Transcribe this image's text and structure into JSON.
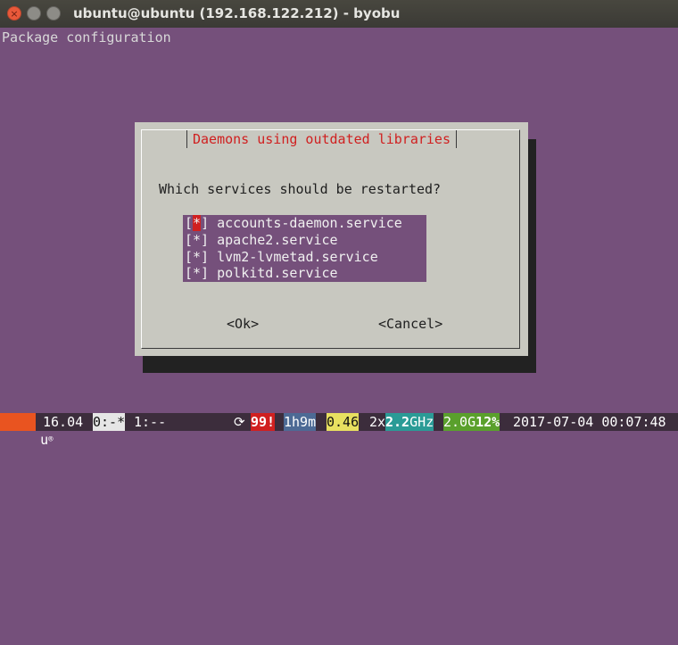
{
  "window": {
    "title": "ubuntu@ubuntu (192.168.122.212) - byobu",
    "close_glyph": "×"
  },
  "terminal": {
    "header": "Package configuration"
  },
  "dialog": {
    "title": "Daemons using outdated libraries",
    "prompt": "Which services should be restarted?",
    "items": [
      {
        "mark": "[*]",
        "label": "accounts-daemon.service"
      },
      {
        "mark": "[*]",
        "label": "apache2.service"
      },
      {
        "mark": "[*]",
        "label": "lvm2-lvmetad.service"
      },
      {
        "mark": "[*]",
        "label": "polkitd.service"
      }
    ],
    "ok_label": "<Ok>",
    "cancel_label": "<Cancel>"
  },
  "statusbar": {
    "logo": "u",
    "logo_mark": "®",
    "version": "16.04",
    "window0": "0:-*",
    "window1": "1:--",
    "updates_icon": "⟳",
    "updates": "99!",
    "uptime": "1h9m",
    "load": "0.46",
    "cpu_count": "2x",
    "cpu_freq_value": "2.2",
    "cpu_freq_unit": "GHz",
    "mem_value": "2.0G",
    "mem_pct": "12%",
    "datetime": "2017-07-04 00:07:48"
  },
  "colors": {
    "terminal_bg": "#75507b",
    "dialog_bg": "#c8c8c0",
    "accent_red": "#d02020",
    "statusbar_bg": "#3c2d3c"
  }
}
